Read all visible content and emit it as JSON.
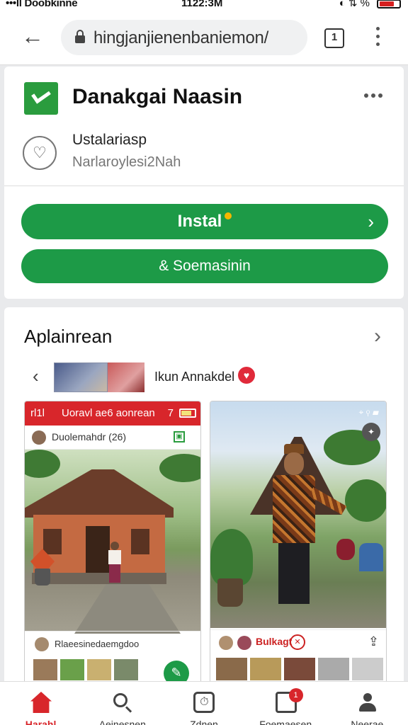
{
  "status_bar": {
    "carrier": "•••ll Doobkinne",
    "wifi_icon": "wifi-icon",
    "time": "1122:3M",
    "indicators": "◐ ⇅ %",
    "battery_icon": "battery-icon"
  },
  "browser": {
    "url": "hingjanjienenbaniemon/",
    "tabs_count": "1"
  },
  "app": {
    "name": "Danakgai Naasin",
    "developer": "Ustalariasp",
    "developer_sub": "Narlaroylesi2Nah",
    "install_label": "Instal",
    "second_label": "& Soemasinin",
    "brand_color": "#1d9a47"
  },
  "screenshots_section": {
    "title": "Aplainrean",
    "strip_label": "Ikun Annakdel",
    "shot1": {
      "top_left": "rl1l",
      "top_title": "Uoravl ae6 aonrean",
      "top_flag": "7",
      "header": "Duolemahdr (26)",
      "footer": "Rlaeesinedaemgdoo"
    },
    "shot2": {
      "status_icons": "⌖ ⚲ ▰",
      "footer": "Bulkagt"
    }
  },
  "bottom_nav": {
    "items": [
      {
        "label": "Harahl",
        "icon": "home-icon",
        "active": true
      },
      {
        "label": "Aeinesnen",
        "icon": "search-icon",
        "active": false
      },
      {
        "label": "Zdnen",
        "icon": "clock-icon",
        "active": false
      },
      {
        "label": "Foemaesen",
        "icon": "chat-icon",
        "active": false,
        "badge": "1"
      },
      {
        "label": "Neerae",
        "icon": "user-icon",
        "active": false
      }
    ]
  }
}
